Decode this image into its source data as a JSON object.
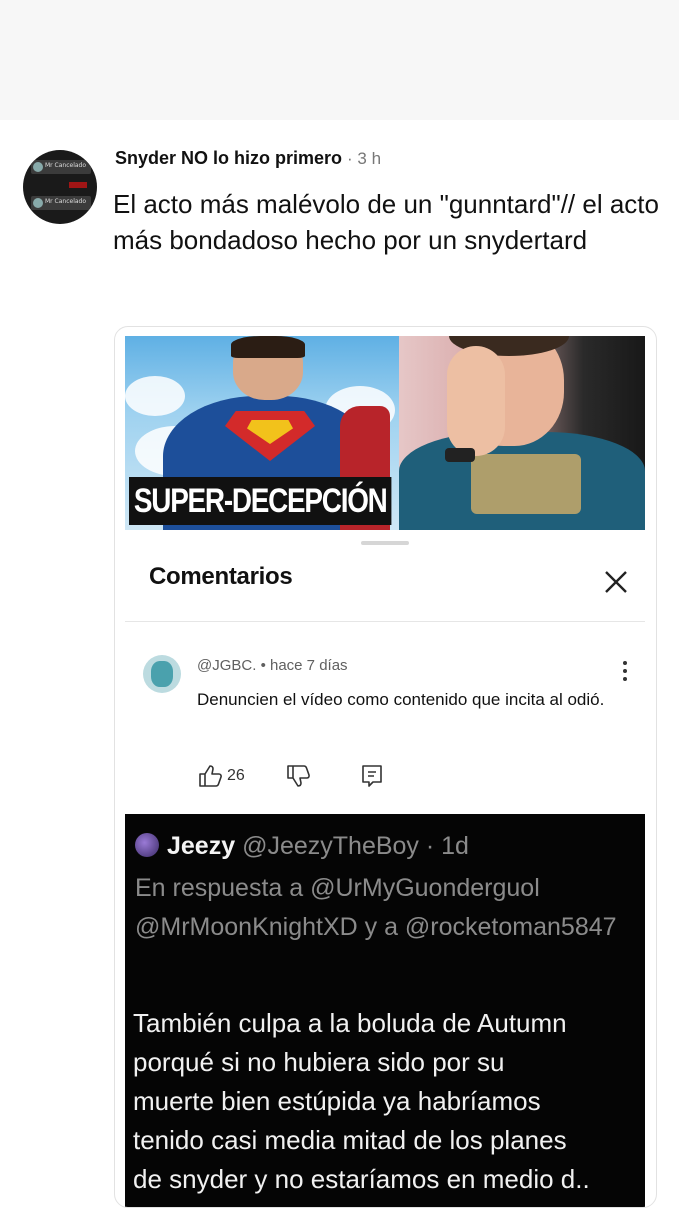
{
  "post": {
    "author": "Snyder NO lo hizo primero",
    "time": "· 3 h",
    "text": "El acto más malévolo de un \"gunntard\"// el acto más bondadoso hecho por un snydertard",
    "avatar_labels": [
      "Mr Cancelado",
      "Mr Cancelado"
    ]
  },
  "thumbnail": {
    "caption": "SUPER-DECEPCIÓN"
  },
  "comments_sheet": {
    "title": "Comentarios",
    "comment": {
      "meta": "@JGBC. • hace 7 días",
      "text": "Denuncien el vídeo como contenido que incita al odió.",
      "likes": "26"
    }
  },
  "tweet": {
    "name": "Jeezy",
    "handle": "@JeezyTheBoy · 1d",
    "reply_to": "En respuesta a @UrMyGuonderguol @MrMoonKnightXD y a @rocketoman5847",
    "body_lines": [
      "También culpa a la boluda de Autumn",
      "porqué si no hubiera sido por su",
      "muerte bien estúpida ya habríamos",
      "tenido casi media mitad de los planes",
      "de snyder y no estaríamos en medio d.."
    ]
  },
  "colors": {
    "top_bar": "#f7f7f7",
    "tweet_bg": "#050505",
    "muted_text": "#777777"
  }
}
